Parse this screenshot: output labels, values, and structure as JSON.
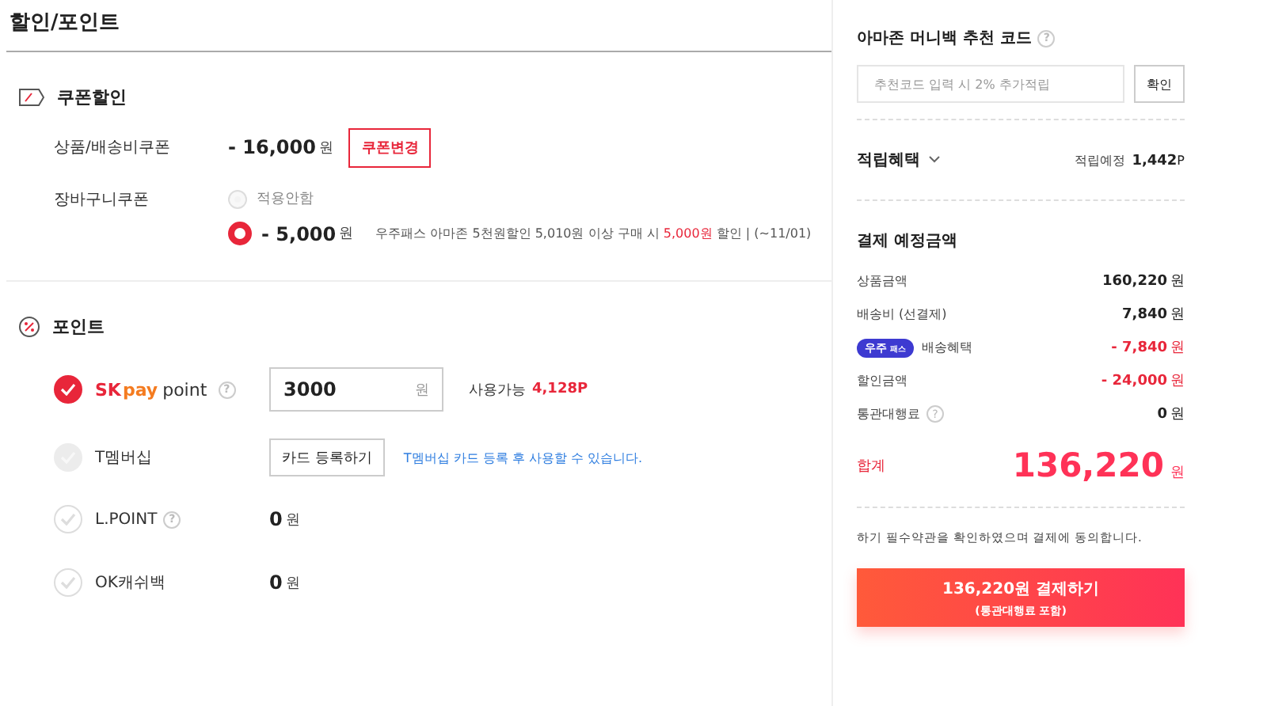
{
  "title": "할인/포인트",
  "coupon_section": {
    "title": "쿠폰할인",
    "product_coupon": {
      "label": "상품/배송비쿠폰",
      "amount": "- 16,000",
      "unit": "원",
      "button": "쿠폰변경"
    },
    "cart_coupon": {
      "label": "장바구니쿠폰",
      "options": [
        {
          "kind": "none",
          "label": "적용안함",
          "selected": false
        },
        {
          "kind": "coupon",
          "amount": "- 5,000",
          "unit": "원",
          "description": "우주패스 아마존 5천원할인 5,010원 이상 구매 시 **5,000원** 할인 | (~11/01)",
          "selected": true
        }
      ]
    }
  },
  "point_section": {
    "title": "포인트",
    "items": [
      {
        "kind": "input",
        "logo_parts": [
          "SK",
          "pay",
          "point"
        ],
        "help": "?",
        "checked": true,
        "disabled": false,
        "value": "3000",
        "unit": "원",
        "available_label": "사용가능",
        "available": "4,128P"
      },
      {
        "kind": "register",
        "label": "T멤버십",
        "checked": false,
        "disabled": true,
        "button": "카드 등록하기",
        "note": "T멤버십 카드 등록 후 사용할 수 있습니다."
      },
      {
        "kind": "amount",
        "label": "L.POINT",
        "help": "?",
        "checked": false,
        "disabled": false,
        "amount": "0",
        "unit": "원"
      },
      {
        "kind": "amount",
        "label": "OK캐쉬백",
        "checked": false,
        "disabled": false,
        "amount": "0",
        "unit": "원"
      }
    ]
  },
  "sidebar": {
    "referral": {
      "title": "아마존 머니백 추천 코드",
      "help": "?",
      "placeholder": "추천코드 입력 시 2% 추가적립",
      "button": "확인"
    },
    "reward": {
      "title": "적립혜택",
      "expanded": false,
      "label": "적립예정",
      "value": "1,442",
      "unit": "P"
    },
    "payment": {
      "title": "결제 예정금액",
      "rows": [
        {
          "kind": "plain",
          "label": "상품금액",
          "amount": "160,220",
          "unit": "원",
          "negative": false
        },
        {
          "kind": "plain",
          "label": "배송비 (선결제)",
          "amount": "7,840",
          "unit": "원",
          "negative": false
        },
        {
          "kind": "badge",
          "badge": "우주",
          "badge_sub": "패스",
          "label": "배송혜택",
          "amount": "- 7,840",
          "unit": "원",
          "negative": true
        },
        {
          "kind": "plain",
          "label": "할인금액",
          "amount": "- 24,000",
          "unit": "원",
          "negative": true
        },
        {
          "kind": "help",
          "label": "통관대행료",
          "help": "?",
          "amount": "0",
          "unit": "원",
          "negative": false
        }
      ],
      "total_label": "합계",
      "total": "136,220",
      "total_unit": "원"
    },
    "agreement": "하기 필수약관을 확인하였으며 결제에 동의합니다.",
    "pay_button": {
      "label": "136,220원 결제하기",
      "sub": "(통관대행료 포함)"
    }
  }
}
